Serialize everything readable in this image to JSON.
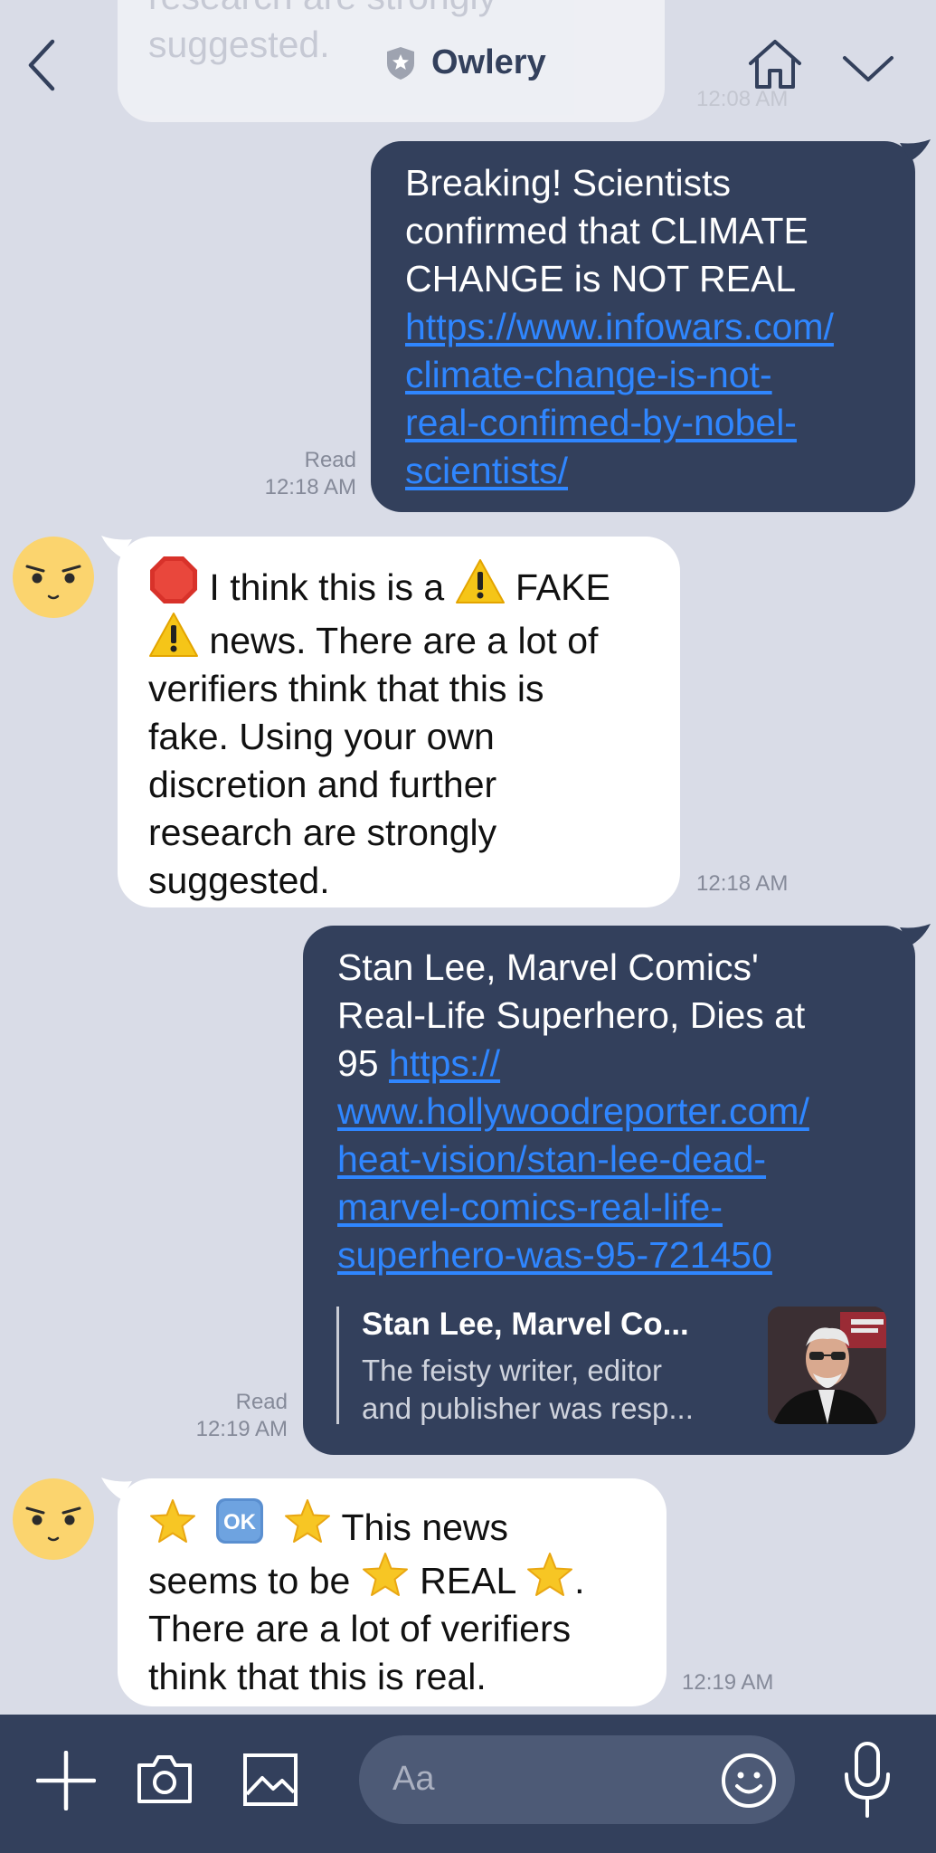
{
  "header": {
    "title": "Owlery",
    "back_icon": "chevron-left-icon",
    "home_icon": "home-icon",
    "menu_icon": "chevron-down-icon"
  },
  "messages": {
    "top_clipped": {
      "line1": "research are strongly",
      "line2": "suggested.",
      "time": "12:08 AM"
    },
    "m1": {
      "lines": [
        "Breaking! Scientists",
        "confirmed that CLIMATE",
        "CHANGE is NOT REAL"
      ],
      "link_lines": [
        "https://www.infowars.com/",
        "climate-change-is-not-",
        "real-confimed-by-nobel-",
        "scientists/"
      ],
      "read": "Read",
      "time": "12:18 AM"
    },
    "m2": {
      "segments": [
        "I think this is a",
        "FAKE"
      ],
      "lines": [
        "news. There are a lot of",
        "verifiers think that this is",
        "fake. Using your own",
        "discretion and further",
        "research are strongly",
        "suggested."
      ],
      "time": "12:18 AM"
    },
    "m3": {
      "lines": [
        "Stan Lee, Marvel Comics'",
        "Real-Life Superhero, Dies at"
      ],
      "line3_prefix": "95",
      "link_lines": [
        "https://",
        "www.hollywoodreporter.com/",
        "heat-vision/stan-lee-dead-",
        "marvel-comics-real-life-",
        "superhero-was-95-721450"
      ],
      "preview_title": "Stan Lee, Marvel Co...",
      "preview_desc1": "The feisty writer, editor",
      "preview_desc2": "and publisher was resp...",
      "read": "Read",
      "time": "12:19 AM"
    },
    "m4": {
      "seg1": "This news",
      "seg2": "seems to be",
      "seg3": "REAL",
      "seg4": ".",
      "line3": "There are a lot of verifiers",
      "line4": "think that this is real.",
      "time": "12:19 AM"
    }
  },
  "input": {
    "placeholder": "Aa",
    "icons": [
      "plus-icon",
      "camera-icon",
      "image-icon",
      "emoji-icon",
      "microphone-icon"
    ]
  },
  "colors": {
    "background": "#d9dce7",
    "outgoing_bubble": "#33405c",
    "incoming_bubble": "#ffffff",
    "link": "#2f86ff",
    "input_bar": "#33405c"
  }
}
